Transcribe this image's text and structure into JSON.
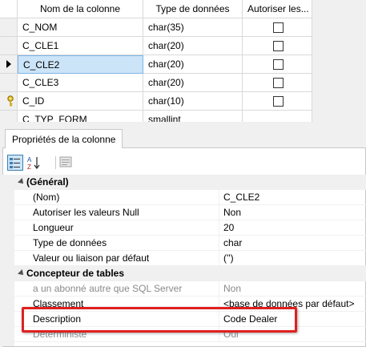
{
  "columns_grid": {
    "headers": [
      "Nom de la colonne",
      "Type de données",
      "Autoriser les..."
    ],
    "rows": [
      {
        "name": "C_NOM",
        "type": "char(35)",
        "marker": ""
      },
      {
        "name": "C_CLE1",
        "type": "char(20)",
        "marker": ""
      },
      {
        "name": "C_CLE2",
        "type": "char(20)",
        "marker": "current-row-arrow"
      },
      {
        "name": "C_CLE3",
        "type": "char(20)",
        "marker": ""
      },
      {
        "name": "C_ID",
        "type": "char(10)",
        "marker": "primary-key-icon"
      },
      {
        "name": "C_TYP_FORM",
        "type": "smallint",
        "marker": ""
      }
    ]
  },
  "properties_panel": {
    "tab_label": "Propriétés de la colonne",
    "toolbar": [
      "categorized-icon",
      "alphabetical-sort-icon",
      "property-pages-icon"
    ],
    "rows": [
      {
        "kind": "category",
        "name": "(Général)"
      },
      {
        "kind": "prop",
        "name": "(Nom)",
        "value": "C_CLE2"
      },
      {
        "kind": "prop",
        "name": "Autoriser les valeurs Null",
        "value": "Non"
      },
      {
        "kind": "prop",
        "name": "Longueur",
        "value": "20"
      },
      {
        "kind": "prop",
        "name": "Type de données",
        "value": "char"
      },
      {
        "kind": "prop",
        "name": "Valeur ou liaison par défaut",
        "value": "('')"
      },
      {
        "kind": "category",
        "name": "Concepteur de tables"
      },
      {
        "kind": "prop-disabled",
        "name": "a un abonné autre que SQL Server",
        "value": "Non"
      },
      {
        "kind": "prop",
        "name": "Classement",
        "value": "<base de données par défaut>"
      },
      {
        "kind": "prop",
        "name": "Description",
        "value": "Code Dealer"
      },
      {
        "kind": "prop-disabled",
        "name": "Déterministe",
        "value": "Oui"
      }
    ]
  },
  "colors": {
    "selection": "#cce4f7",
    "highlight_box": "#e02020"
  }
}
